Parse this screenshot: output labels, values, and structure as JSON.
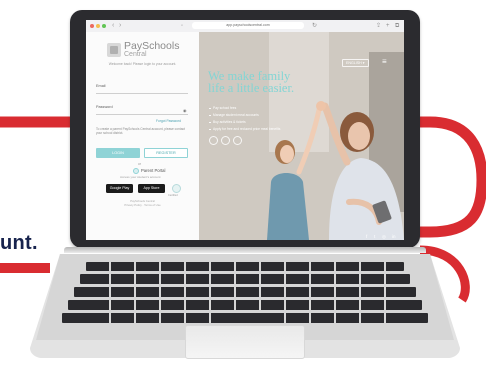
{
  "tagline": "unt.",
  "browser": {
    "url": "app.payschoolscentral.com"
  },
  "login": {
    "logo_line1": "PaySchools",
    "logo_line2": "Central",
    "welcome": "Welcome back! Please login to your account.",
    "email_label": "Email",
    "password_label": "Password",
    "forgot": "Forgot Password",
    "info": "To create a parent PaySchools Central account, please contact your school district.",
    "login_button": "LOGIN",
    "register_button": "REGISTER",
    "or_label": "or",
    "parent_portal": "Parent Portal",
    "portal_sub": "Access your student's account",
    "google_play": "Google Play",
    "app_store": "App Store",
    "cert_label": "Certified",
    "footer_line1": "PaySchools Central",
    "footer_line2": "Privacy Policy · Terms of Use"
  },
  "hero": {
    "language": "ENGLISH ▾",
    "headline_line1": "We make family",
    "headline_line2": "life a little easier.",
    "bullets": [
      "Pay school fees",
      "Manage student meal accounts",
      "Buy activities & tickets",
      "Apply for free and reduced price meal benefits"
    ],
    "social": [
      "f",
      "t",
      "◎",
      "in"
    ]
  },
  "colors": {
    "accent_teal": "#83d5d4",
    "button_teal": "#8fd3d6",
    "swoosh_red": "#d92c31",
    "swoosh_navy": "#17234d"
  }
}
